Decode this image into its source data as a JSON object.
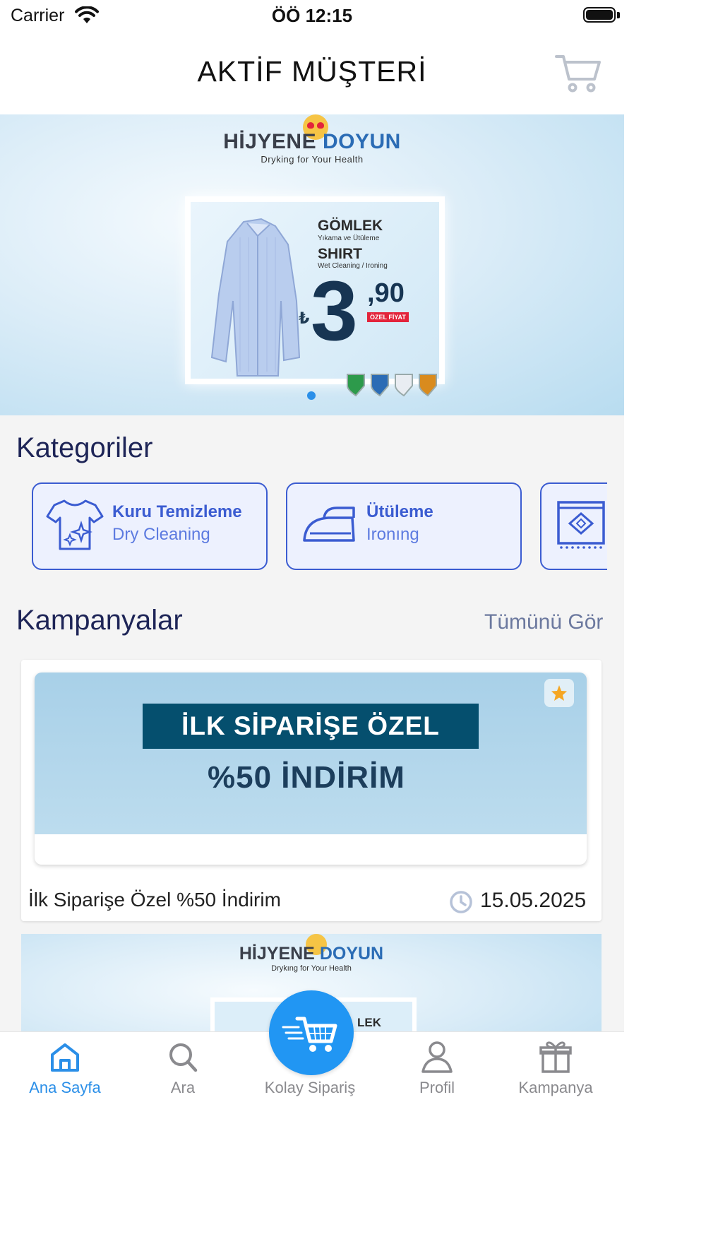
{
  "status_bar": {
    "carrier": "Carrier",
    "time": "ÖÖ 12:15"
  },
  "header": {
    "title": "AKTİF MÜŞTERİ"
  },
  "hero": {
    "brand_part1": "HİJYENE",
    "brand_part2": "DOYUN",
    "brand_tagline": "Dryking for Your Health",
    "product_tr": "GÖMLEK",
    "product_tr_sub": "Yıkama ve Ütüleme",
    "product_en": "SHIRT",
    "product_en_sub": "Wet Cleaning / Ironing",
    "currency": "₺",
    "price_main": "3",
    "price_decimal": ",90",
    "price_tag": "ÖZEL FİYAT",
    "carousel_index": 1,
    "carousel_count": 1
  },
  "categories": {
    "title": "Kategoriler",
    "items": [
      {
        "title": "Kuru Temizleme",
        "subtitle": "Dry Cleaning",
        "icon": "dry-cleaning-shirt-icon"
      },
      {
        "title": "Ütüleme",
        "subtitle": "Ironıng",
        "icon": "iron-icon"
      },
      {
        "title": "",
        "subtitle": "",
        "icon": "carpet-icon"
      }
    ]
  },
  "campaigns": {
    "title": "Kampanyalar",
    "see_all": "Tümünü Gör",
    "items": [
      {
        "band_text": "İLK SİPARİŞE ÖZEL",
        "discount_text": "%50 İNDİRİM",
        "name": "İlk Siparişe Özel %50 İndirim",
        "date": "15.05.2025",
        "favorite": true
      }
    ],
    "next_banner": {
      "brand_part1": "HİJYENE",
      "brand_part2": "DOYUN",
      "tagline": "Drykıng for Your Health",
      "product_fragment": "LEK"
    }
  },
  "tabbar": {
    "items": [
      {
        "label": "Ana Sayfa",
        "icon": "home-icon",
        "active": true
      },
      {
        "label": "Ara",
        "icon": "search-icon",
        "active": false
      },
      {
        "label": "Kolay Sipariş",
        "icon": "fast-cart-icon",
        "active": false
      },
      {
        "label": "Profil",
        "icon": "profile-icon",
        "active": false
      },
      {
        "label": "Kampanya",
        "icon": "gift-icon",
        "active": false
      }
    ]
  },
  "colors": {
    "accent": "#2b8fe8",
    "category_border": "#3b5cd1",
    "heading": "#1e2557",
    "campaign_band": "#054f6e"
  }
}
